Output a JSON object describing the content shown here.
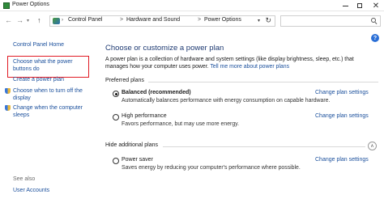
{
  "window": {
    "title": "Power Options",
    "icon": "power-options-app-icon"
  },
  "address": {
    "breadcrumb": [
      "Control Panel",
      "Hardware and Sound",
      "Power Options"
    ],
    "separator": ">",
    "search_placeholder": ""
  },
  "sidebar": {
    "home": "Control Panel Home",
    "items": [
      "Choose what the power buttons do",
      "Create a power plan",
      "Choose when to turn off the display",
      "Change when the computer sleeps"
    ],
    "see_also_label": "See also",
    "see_also_items": [
      "User Accounts"
    ]
  },
  "main": {
    "heading": "Choose or customize a power plan",
    "intro_text": "A power plan is a collection of hardware and system settings (like display brightness, sleep, etc.) that manages how your computer uses power.",
    "intro_link": "Tell me more about power plans",
    "preferred_label": "Preferred plans",
    "hidden_label": "Hide additional plans",
    "plans": [
      {
        "name": "Balanced (recommended)",
        "desc": "Automatically balances performance with energy consumption on capable hardware.",
        "link": "Change plan settings",
        "selected": true
      },
      {
        "name": "High performance",
        "desc": "Favors performance, but may use more energy.",
        "link": "Change plan settings",
        "selected": false
      },
      {
        "name": "Power saver",
        "desc": "Saves energy by reducing your computer's performance where possible.",
        "link": "Change plan settings",
        "selected": false
      }
    ]
  },
  "colors": {
    "link": "#1a4f9c",
    "heading": "#1e3a72",
    "highlight": "#e01b24"
  }
}
